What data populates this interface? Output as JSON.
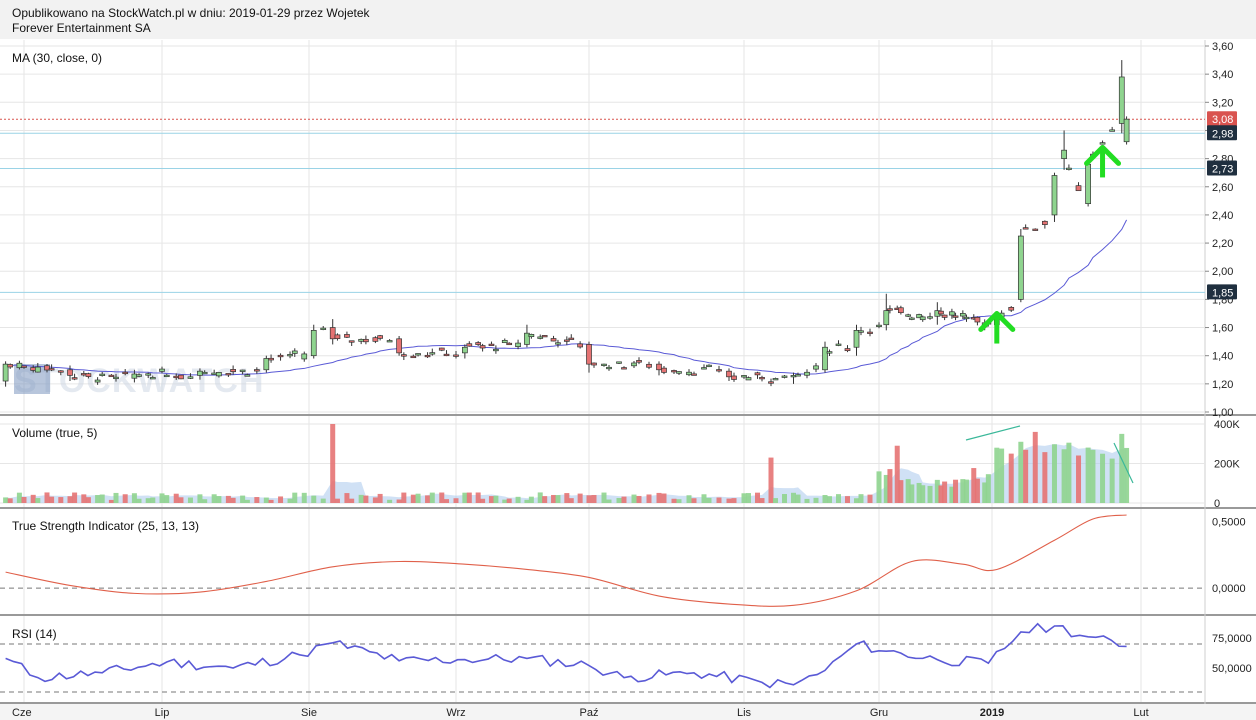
{
  "header": {
    "published_line": "Opublikowano na StockWatch.pl w dniu: 2019-01-29 przez Wojetek",
    "company": "Forever Entertainment SA"
  },
  "watermark": "STOCKWATCH",
  "colors": {
    "up": "#8fd48f",
    "down": "#e57373",
    "ma_line": "#5a5ad6",
    "tsi_line": "#e0604a",
    "rsi_line": "#5a5ad6",
    "hline": "#9ad3e6",
    "price_marker": "#d9534f",
    "arrow": "#22dd22",
    "grid": "#e6e6e6"
  },
  "x_axis_labels": [
    "Cze",
    "Lip",
    "Sie",
    "Wrz",
    "Paź",
    "Lis",
    "Gru",
    "2019",
    "Lut"
  ],
  "chart_data": [
    {
      "type": "candlestick",
      "title": "MA (30, close, 0)",
      "ylim": [
        1.0,
        3.6
      ],
      "y_ticks": [
        "1,00",
        "1,20",
        "1,40",
        "1,60",
        "1,80",
        "2,00",
        "2,20",
        "2,40",
        "2,60",
        "2,80",
        "3,00",
        "3,20",
        "3,40",
        "3,60"
      ],
      "price_markers": [
        {
          "value": 3.08,
          "label": "3,08",
          "style": "last-price"
        },
        {
          "value": 2.98,
          "label": "2,98",
          "style": "level"
        },
        {
          "value": 2.73,
          "label": "2,73",
          "style": "level"
        },
        {
          "value": 1.85,
          "label": "1,85",
          "style": "level"
        }
      ],
      "horizontal_lines": [
        2.98,
        2.73,
        1.85
      ],
      "last_price_line": 3.08,
      "candles": [
        {
          "date": "2018-05-28",
          "o": 1.22,
          "h": 1.36,
          "l": 1.18,
          "c": 1.34
        },
        {
          "date": "2018-06-11",
          "o": 1.3,
          "h": 1.33,
          "l": 1.22,
          "c": 1.26
        },
        {
          "date": "2018-06-25",
          "o": 1.24,
          "h": 1.3,
          "l": 1.21,
          "c": 1.27
        },
        {
          "date": "2018-07-09",
          "o": 1.26,
          "h": 1.31,
          "l": 1.23,
          "c": 1.29
        },
        {
          "date": "2018-07-23",
          "o": 1.3,
          "h": 1.4,
          "l": 1.28,
          "c": 1.38
        },
        {
          "date": "2018-08-02",
          "o": 1.4,
          "h": 1.62,
          "l": 1.38,
          "c": 1.58
        },
        {
          "date": "2018-08-06",
          "o": 1.6,
          "h": 1.66,
          "l": 1.48,
          "c": 1.52
        },
        {
          "date": "2018-08-20",
          "o": 1.52,
          "h": 1.54,
          "l": 1.4,
          "c": 1.42
        },
        {
          "date": "2018-09-03",
          "o": 1.42,
          "h": 1.48,
          "l": 1.38,
          "c": 1.46
        },
        {
          "date": "2018-09-17",
          "o": 1.48,
          "h": 1.62,
          "l": 1.46,
          "c": 1.56
        },
        {
          "date": "2018-10-01",
          "o": 1.48,
          "h": 1.5,
          "l": 1.28,
          "c": 1.34
        },
        {
          "date": "2018-10-15",
          "o": 1.34,
          "h": 1.36,
          "l": 1.26,
          "c": 1.3
        },
        {
          "date": "2018-10-29",
          "o": 1.29,
          "h": 1.31,
          "l": 1.22,
          "c": 1.25
        },
        {
          "date": "2018-11-12",
          "o": 1.25,
          "h": 1.28,
          "l": 1.2,
          "c": 1.26
        },
        {
          "date": "2018-11-19",
          "o": 1.3,
          "h": 1.5,
          "l": 1.28,
          "c": 1.46
        },
        {
          "date": "2018-11-26",
          "o": 1.46,
          "h": 1.62,
          "l": 1.4,
          "c": 1.58
        },
        {
          "date": "2018-12-03",
          "o": 1.62,
          "h": 1.84,
          "l": 1.58,
          "c": 1.72
        },
        {
          "date": "2018-12-17",
          "o": 1.68,
          "h": 1.78,
          "l": 1.62,
          "c": 1.72
        },
        {
          "date": "2019-01-02",
          "o": 1.62,
          "h": 1.68,
          "l": 1.6,
          "c": 1.66
        },
        {
          "date": "2019-01-07",
          "o": 1.8,
          "h": 2.3,
          "l": 1.78,
          "c": 2.25
        },
        {
          "date": "2019-01-14",
          "o": 2.4,
          "h": 2.7,
          "l": 2.35,
          "c": 2.68
        },
        {
          "date": "2019-01-16",
          "o": 2.8,
          "h": 3.0,
          "l": 2.72,
          "c": 2.86
        },
        {
          "date": "2019-01-21",
          "o": 2.48,
          "h": 2.78,
          "l": 2.46,
          "c": 2.76
        },
        {
          "date": "2019-01-28",
          "o": 3.05,
          "h": 3.5,
          "l": 2.98,
          "c": 3.38
        },
        {
          "date": "2019-01-29",
          "o": 2.92,
          "h": 3.1,
          "l": 2.9,
          "c": 3.08
        }
      ],
      "ma_series": {
        "name": "MA (30, close, 0)",
        "note": "30-period moving average of close"
      }
    },
    {
      "type": "bar",
      "title": "Volume (true, 5)",
      "ylim": [
        0,
        400000
      ],
      "y_ticks": [
        "0",
        "200K",
        "400K"
      ],
      "peak_values": [
        {
          "date": "2018-08-06",
          "value": 400000
        },
        {
          "date": "2018-11-07",
          "value": 230000
        },
        {
          "date": "2018-12-06",
          "value": 290000
        },
        {
          "date": "2019-01-02",
          "value": 280000
        },
        {
          "date": "2019-01-07",
          "value": 310000
        },
        {
          "date": "2019-01-10",
          "value": 360000
        },
        {
          "date": "2019-01-28",
          "value": 350000
        }
      ]
    },
    {
      "type": "line",
      "title": "True Strength Indicator (25, 13, 13)",
      "ylim": [
        -0.15,
        0.55
      ],
      "y_ticks": [
        "0,5000",
        "0,0000"
      ],
      "dashed_reference": [
        0.0
      ],
      "series": [
        {
          "name": "True Strength Indicator (25, 13, 13)",
          "points": [
            {
              "date": "2018-05-28",
              "value": 0.12
            },
            {
              "date": "2018-06-11",
              "value": 0.02
            },
            {
              "date": "2018-06-25",
              "value": -0.04
            },
            {
              "date": "2018-07-09",
              "value": -0.03
            },
            {
              "date": "2018-07-23",
              "value": 0.05
            },
            {
              "date": "2018-08-06",
              "value": 0.16
            },
            {
              "date": "2018-08-20",
              "value": 0.2
            },
            {
              "date": "2018-09-03",
              "value": 0.18
            },
            {
              "date": "2018-09-17",
              "value": 0.14
            },
            {
              "date": "2018-10-01",
              "value": 0.08
            },
            {
              "date": "2018-10-15",
              "value": -0.06
            },
            {
              "date": "2018-10-29",
              "value": -0.12
            },
            {
              "date": "2018-11-12",
              "value": -0.13
            },
            {
              "date": "2018-11-26",
              "value": -0.02
            },
            {
              "date": "2018-12-10",
              "value": 0.2
            },
            {
              "date": "2018-12-24",
              "value": 0.18
            },
            {
              "date": "2019-01-02",
              "value": 0.14
            },
            {
              "date": "2019-01-14",
              "value": 0.36
            },
            {
              "date": "2019-01-22",
              "value": 0.52
            },
            {
              "date": "2019-01-29",
              "value": 0.55
            }
          ]
        }
      ]
    },
    {
      "type": "line",
      "title": "RSI (14)",
      "ylim": [
        25,
        90
      ],
      "y_ticks": [
        "75,0000",
        "50,0000"
      ],
      "dashed_reference": [
        70,
        30
      ],
      "series": [
        {
          "name": "RSI (14)",
          "points": [
            {
              "date": "2018-05-28",
              "value": 58
            },
            {
              "date": "2018-06-04",
              "value": 42
            },
            {
              "date": "2018-06-18",
              "value": 46
            },
            {
              "date": "2018-07-02",
              "value": 55
            },
            {
              "date": "2018-07-16",
              "value": 50
            },
            {
              "date": "2018-07-30",
              "value": 61
            },
            {
              "date": "2018-08-06",
              "value": 71
            },
            {
              "date": "2018-08-20",
              "value": 56
            },
            {
              "date": "2018-09-03",
              "value": 57
            },
            {
              "date": "2018-09-17",
              "value": 58
            },
            {
              "date": "2018-10-01",
              "value": 52
            },
            {
              "date": "2018-10-08",
              "value": 42
            },
            {
              "date": "2018-10-22",
              "value": 46
            },
            {
              "date": "2018-11-05",
              "value": 38
            },
            {
              "date": "2018-11-12",
              "value": 36
            },
            {
              "date": "2018-11-19",
              "value": 48
            },
            {
              "date": "2018-11-26",
              "value": 70
            },
            {
              "date": "2018-12-03",
              "value": 64
            },
            {
              "date": "2018-12-17",
              "value": 57
            },
            {
              "date": "2018-12-31",
              "value": 54
            },
            {
              "date": "2019-01-07",
              "value": 80
            },
            {
              "date": "2019-01-14",
              "value": 85
            },
            {
              "date": "2019-01-21",
              "value": 76
            },
            {
              "date": "2019-01-29",
              "value": 68
            }
          ]
        }
      ]
    }
  ]
}
